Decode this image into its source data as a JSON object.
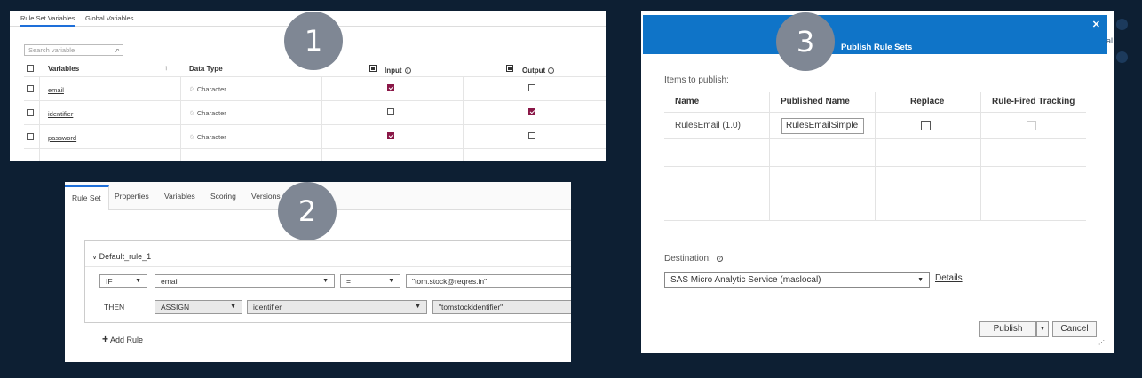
{
  "panel1": {
    "tabs": [
      "Rule Set Variables",
      "Global Variables"
    ],
    "search_placeholder": "Search variable",
    "search_icon": "magnifier-icon",
    "columns": {
      "variables": "Variables",
      "sort_icon": "↑",
      "data_type": "Data Type",
      "input": "Input",
      "output": "Output"
    },
    "rows": [
      {
        "name": "email",
        "type": "Character",
        "input": true,
        "output": false
      },
      {
        "name": "identifier",
        "type": "Character",
        "input": false,
        "output": true
      },
      {
        "name": "password",
        "type": "Character",
        "input": true,
        "output": false
      }
    ],
    "type_icon": "character-type-icon",
    "checked_color": "#8a1747"
  },
  "panel2": {
    "tabs": [
      "Rule Set",
      "Properties",
      "Variables",
      "Scoring",
      "Versions"
    ],
    "rule_name": "Default_rule_1",
    "if_row": {
      "keyword": "IF",
      "variable": "email",
      "operator": "=",
      "value": "\"tom.stock@reqres.in\""
    },
    "then_row": {
      "keyword": "THEN",
      "action": "ASSIGN",
      "variable": "identifier",
      "value": "\"tomstockidentifier\""
    },
    "add_rule": "Add Rule"
  },
  "panel3": {
    "title": "Publish Rule Sets",
    "items_label": "Items to publish:",
    "columns": [
      "Name",
      "Published Name",
      "Replace",
      "Rule-Fired Tracking"
    ],
    "row": {
      "name": "RulesEmail (1.0)",
      "published_name": "RulesEmailSimple"
    },
    "destination_label": "Destination:",
    "destination_value": "SAS Micro Analytic Service (maslocal)",
    "details_link": "Details",
    "publish_button": "Publish",
    "cancel_button": "Cancel",
    "header_color": "#0f74c8"
  },
  "badges": [
    "1",
    "2",
    "3"
  ],
  "background_fragment": "al"
}
